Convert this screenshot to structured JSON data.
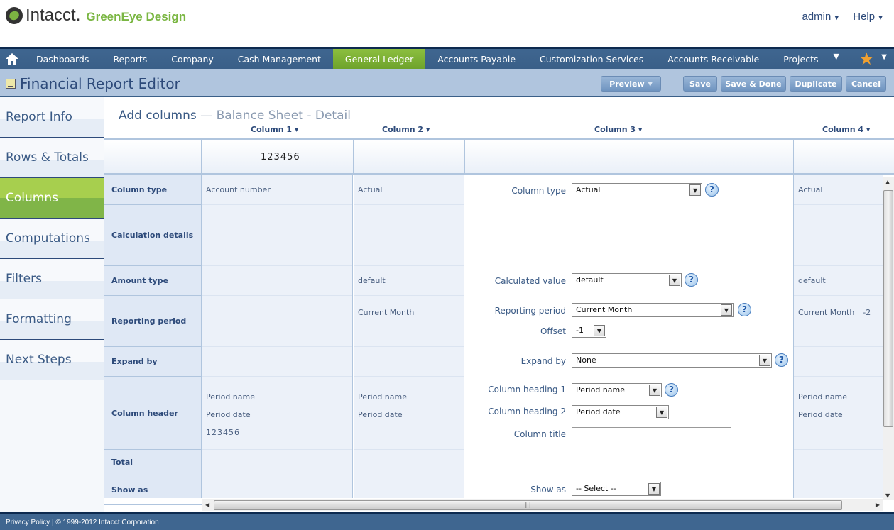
{
  "header": {
    "brand": "Intacct.",
    "company": "GreenEye Design",
    "user_menu": "admin",
    "help_menu": "Help"
  },
  "nav": {
    "items": [
      "Dashboards",
      "Reports",
      "Company",
      "Cash Management",
      "General Ledger",
      "Accounts Payable",
      "Customization Services",
      "Accounts Receivable",
      "Projects"
    ],
    "active": "General Ledger"
  },
  "titlebar": {
    "title": "Financial Report Editor",
    "buttons": {
      "preview": "Preview",
      "save": "Save",
      "save_done": "Save & Done",
      "duplicate": "Duplicate",
      "cancel": "Cancel"
    }
  },
  "sidebar": {
    "items": [
      "Report Info",
      "Rows & Totals",
      "Columns",
      "Computations",
      "Filters",
      "Formatting",
      "Next Steps"
    ],
    "active": "Columns"
  },
  "main": {
    "heading": "Add columns",
    "subheading": "— Balance Sheet - Detail",
    "columns": [
      "Column 1 ▾",
      "Column 2 ▾",
      "Column 3 ▾",
      "Column 4 ▾"
    ],
    "header_row": {
      "col1": "123456"
    },
    "row_labels": [
      "Column type",
      "Calculation details",
      "Amount type",
      "Reporting period",
      "Expand by",
      "Column header",
      "Total",
      "Show as"
    ],
    "col1": {
      "column_type": "Account number",
      "header_line1": "Period name",
      "header_line2": "Period date",
      "header_line3": "123456"
    },
    "col2": {
      "column_type": "Actual",
      "amount_type": "default",
      "reporting_period": "Current Month",
      "header_line1": "Period name",
      "header_line2": "Period date"
    },
    "col3": {
      "column_type_label": "Column type",
      "column_type_value": "Actual",
      "calculated_value_label": "Calculated value",
      "calculated_value": "default",
      "reporting_period_label": "Reporting period",
      "reporting_period_value": "Current Month",
      "offset_label": "Offset",
      "offset_value": "-1",
      "expand_by_label": "Expand by",
      "expand_by_value": "None",
      "heading1_label": "Column heading 1",
      "heading1_value": "Period name",
      "heading2_label": "Column heading 2",
      "heading2_value": "Period date",
      "title_label": "Column title",
      "title_value": "",
      "show_as_label": "Show as",
      "show_as_value": "-- Select --"
    },
    "col4": {
      "column_type": "Actual",
      "amount_type": "default",
      "reporting_period": "Current Month",
      "offset": "-2",
      "header_line1": "Period name",
      "header_line2": "Period date"
    }
  },
  "footer": {
    "text": "Privacy Policy | © 1999-2012  Intacct Corporation"
  }
}
